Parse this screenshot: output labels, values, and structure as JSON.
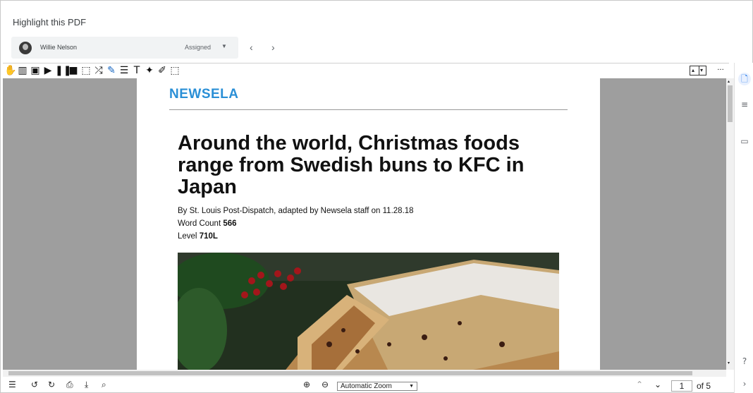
{
  "header": {
    "title": "Highlight this PDF"
  },
  "student": {
    "name": "Willie Nelson",
    "status": "Assigned"
  },
  "nav": {
    "prev": "‹",
    "next": "›"
  },
  "toolbar": {
    "icons": [
      "hand-icon",
      "book-icon",
      "image-icon",
      "play-icon",
      "pause-icon",
      "stop-icon",
      "select-icon",
      "shuffle-icon",
      "highlighter-icon",
      "list-icon",
      "text-icon",
      "pin-icon",
      "marker-icon",
      "frame-icon"
    ],
    "more": "···"
  },
  "document": {
    "publisher": "NEWSELA",
    "headline": "Around the world, Christmas foods range from Swedish buns to KFC in Japan",
    "byline": "By St. Louis Post-Dispatch, adapted by Newsela staff on 11.28.18",
    "word_count_label": "Word Count",
    "word_count": "566",
    "level_label": "Level",
    "level": "710L"
  },
  "bottom": {
    "zoom_label": "Automatic Zoom",
    "page_number": "1",
    "page_total": "of 5"
  },
  "colors": {
    "accent": "#2a8fd6",
    "viewer_bg": "#9e9e9e"
  }
}
